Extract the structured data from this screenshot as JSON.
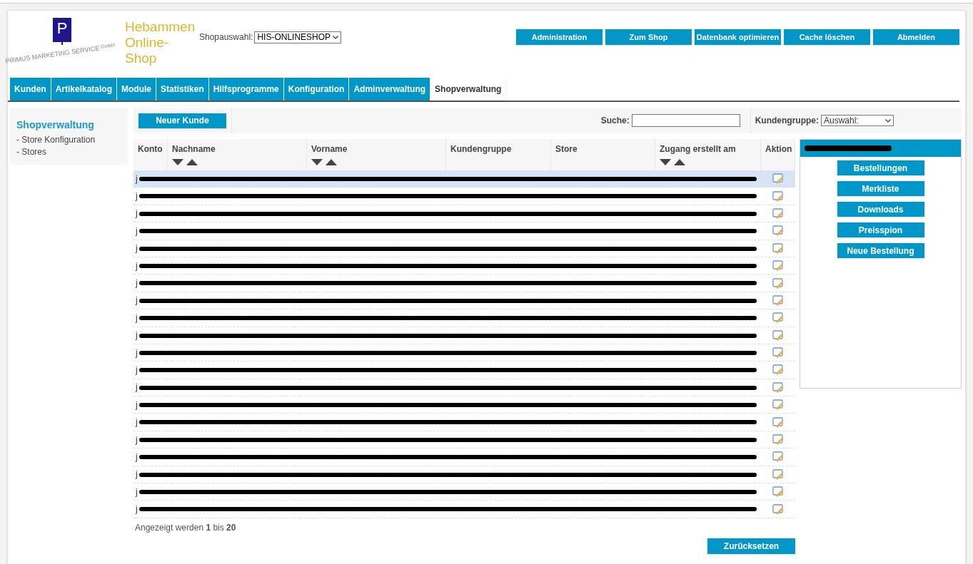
{
  "logo": {
    "letter": "P",
    "company": "PRIMUS MARKETING SERVICE",
    "company_suffix": "GmbH",
    "shop_name_line1": "Hebammen",
    "shop_name_line2": "Online-Shop"
  },
  "shop_select": {
    "label": "Shopauswahl:",
    "value": "HIS-ONLINESHOP"
  },
  "top_buttons": [
    "Administration",
    "Zum Shop",
    "Datenbank optimieren",
    "Cache löschen",
    "Abmelden"
  ],
  "tabs": [
    {
      "label": "Kunden",
      "selected": false
    },
    {
      "label": "Artikelkatalog",
      "selected": false
    },
    {
      "label": "Module",
      "selected": false
    },
    {
      "label": "Statistiken",
      "selected": false
    },
    {
      "label": "Hilfsprogramme",
      "selected": false
    },
    {
      "label": "Konfiguration",
      "selected": false
    },
    {
      "label": "Adminverwaltung",
      "selected": false
    },
    {
      "label": "Shopverwaltung",
      "selected": true
    }
  ],
  "sidebar": {
    "title": "Shopverwaltung",
    "items": [
      "- Store Konfiguration",
      "- Stores"
    ]
  },
  "toolbar": {
    "new_button": "Neuer Kunde",
    "search_label": "Suche:",
    "group_label": "Kundengruppe:",
    "group_value": "Auswahl:"
  },
  "table": {
    "columns": [
      {
        "label": "Konto",
        "sortable": false
      },
      {
        "label": "Nachname",
        "sortable": true
      },
      {
        "label": "Vorname",
        "sortable": true
      },
      {
        "label": "Kundengruppe",
        "sortable": false
      },
      {
        "label": "Store",
        "sortable": false
      },
      {
        "label": "Zugang erstellt am",
        "sortable": true
      },
      {
        "label": "Aktion",
        "sortable": false
      }
    ],
    "rows": [
      {
        "konto": "j",
        "selected": true
      },
      {
        "konto": "j",
        "selected": false
      },
      {
        "konto": "j",
        "selected": false
      },
      {
        "konto": "j",
        "selected": false
      },
      {
        "konto": "j",
        "selected": false
      },
      {
        "konto": "j",
        "selected": false
      },
      {
        "konto": "j",
        "selected": false
      },
      {
        "konto": "j",
        "selected": false
      },
      {
        "konto": "j",
        "selected": false
      },
      {
        "konto": "j",
        "selected": false
      },
      {
        "konto": "j",
        "selected": false
      },
      {
        "konto": "j",
        "selected": false
      },
      {
        "konto": "j",
        "selected": false
      },
      {
        "konto": "j",
        "selected": false
      },
      {
        "konto": "j",
        "selected": false
      },
      {
        "konto": "j",
        "selected": false
      },
      {
        "konto": "j",
        "selected": false
      },
      {
        "konto": "j",
        "selected": false
      },
      {
        "konto": "j",
        "selected": false
      },
      {
        "konto": "j",
        "selected": false
      }
    ]
  },
  "pagination": "Angezeigt werden **1** bis **20**",
  "customer_panel": {
    "buttons": [
      "Bestellungen",
      "Merkliste",
      "Downloads",
      "Preisspion",
      "Neue Bestellung"
    ]
  },
  "reset_button": "Zurücksetzen"
}
